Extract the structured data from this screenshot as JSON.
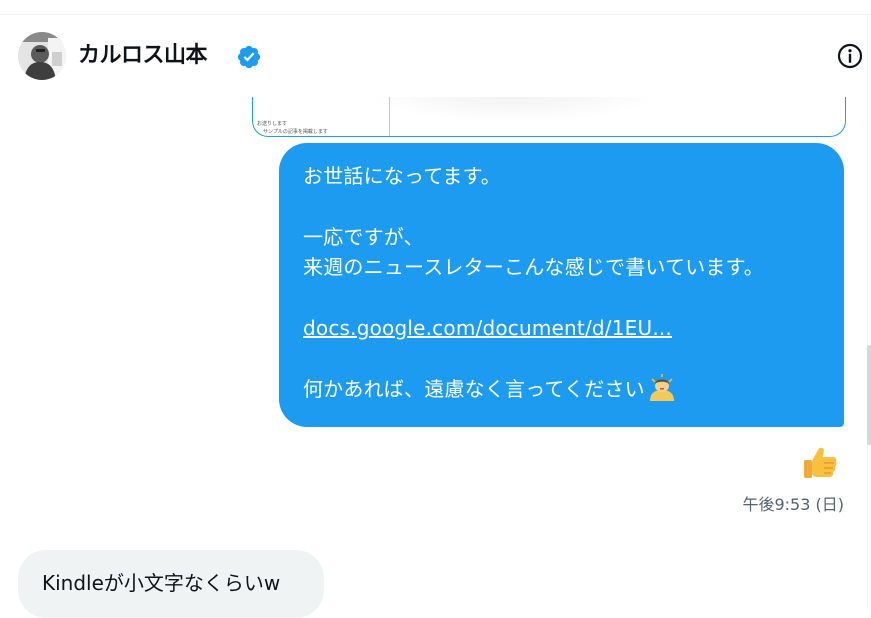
{
  "header": {
    "user_name": "カルロス山本",
    "icons": {
      "verified": "verified-badge-icon",
      "info": "info-icon"
    },
    "colors": {
      "verified": "#1d9bf0"
    }
  },
  "attachment": {
    "preview_text": [
      "",
      "お送りします",
      "サンプルの記事を掲載します"
    ]
  },
  "messages": {
    "sent": {
      "lines": [
        "お世話になってます。",
        "一応ですが、",
        "来週のニュースレターこんな感じで書いています。",
        "docs.google.com/document/d/1EU...",
        "何かあれば、遠慮なく言ってください"
      ],
      "link": "docs.google.com/document/d/1EU...",
      "emoji": "person-bowing-emoji",
      "bubble_color": "#1d9bf0",
      "reaction": "thumbs-up-emoji",
      "timestamp": "午後9:53 (日)"
    },
    "received": {
      "text": "Kindleが小文字なくらいw",
      "bubble_color": "#eff3f4"
    }
  }
}
